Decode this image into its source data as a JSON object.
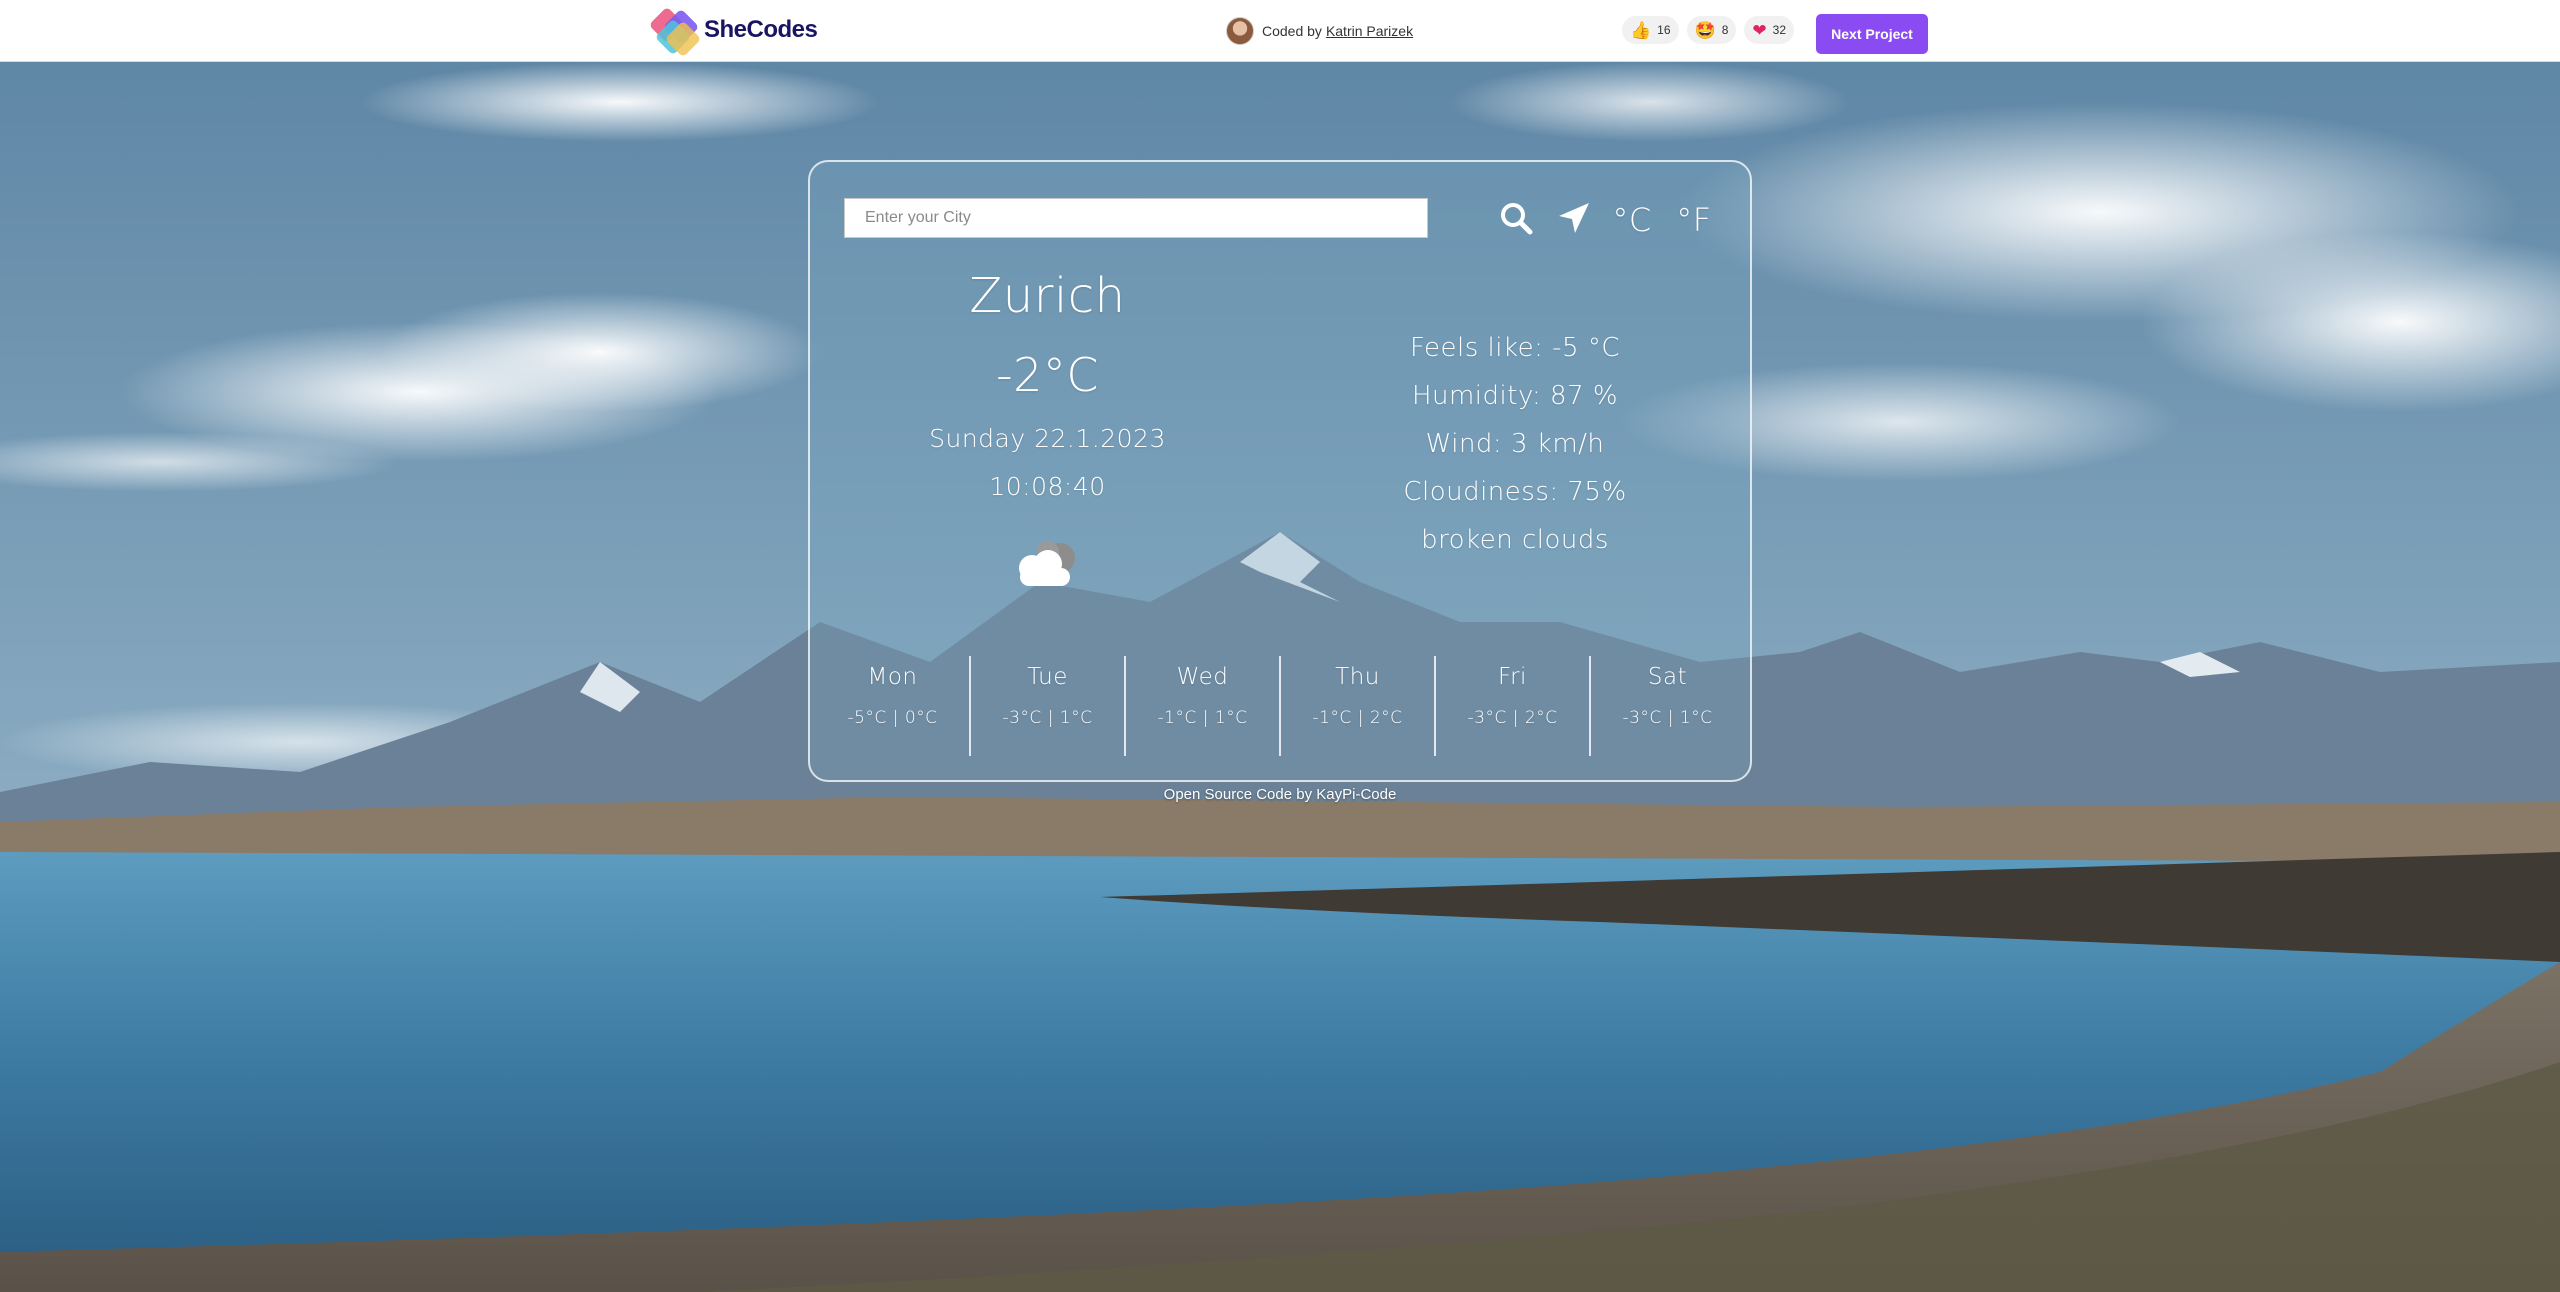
{
  "header": {
    "brand": "SheCodes",
    "coded_by": "Coded by",
    "author_name": "Katrin Parizek",
    "reactions": [
      {
        "icon": "thumbs-up-icon",
        "glyph": "👍",
        "count": "16"
      },
      {
        "icon": "star-struck-icon",
        "glyph": "🤩",
        "count": "8"
      },
      {
        "icon": "heart-icon",
        "glyph": "❤",
        "count": "32"
      }
    ],
    "next_button": "Next Project"
  },
  "search": {
    "placeholder": "Enter your City",
    "value": ""
  },
  "units": {
    "celsius": "°C",
    "fahrenheit": "°F"
  },
  "current": {
    "city": "Zurich",
    "temperature": "-2°C",
    "date": "Sunday 22.1.2023",
    "time": "10:08:40",
    "condition_icon": "cloud-icon"
  },
  "details": {
    "feels_like": "Feels like: -5 °C",
    "humidity": "Humidity: 87 %",
    "wind": "Wind: 3 km/h",
    "cloudiness": "Cloudiness: 75%",
    "description": "broken clouds"
  },
  "forecast": [
    {
      "day": "Mon",
      "range": "-5°C | 0°C"
    },
    {
      "day": "Tue",
      "range": "-3°C | 1°C"
    },
    {
      "day": "Wed",
      "range": "-1°C | 1°C"
    },
    {
      "day": "Thu",
      "range": "-1°C | 2°C"
    },
    {
      "day": "Fri",
      "range": "-3°C | 2°C"
    },
    {
      "day": "Sat",
      "range": "-3°C | 1°C"
    }
  ],
  "footer": {
    "link_text": "Open Source Code by KayPi-Code"
  },
  "colors": {
    "brand_dark": "#1b1464",
    "button_purple": "#8a4cf2",
    "sky": "#6f93ad",
    "lake": "#4f8db2"
  }
}
